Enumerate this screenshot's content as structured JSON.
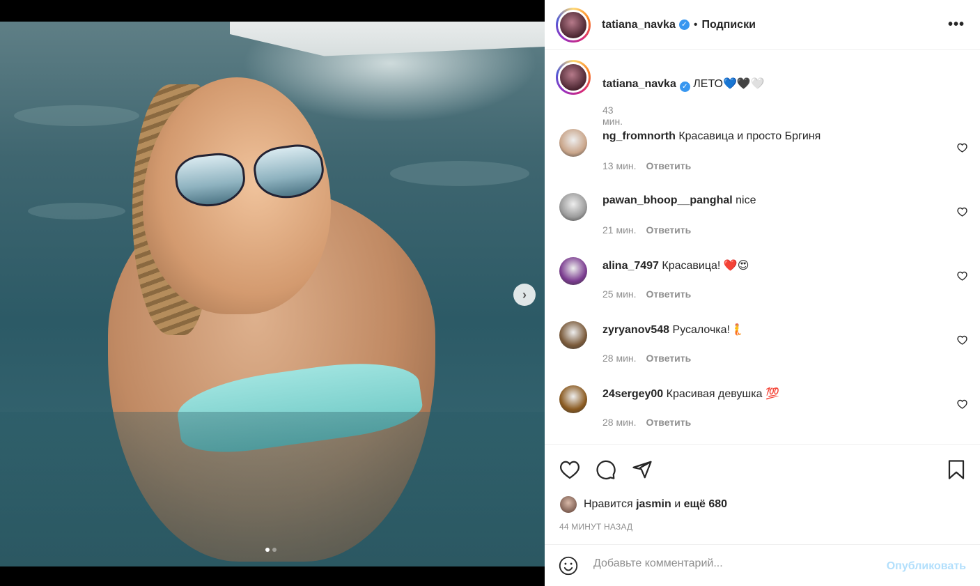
{
  "header": {
    "username": "tatiana_navka",
    "separator": "•",
    "follow_label": "Подписки",
    "more_label": "•••"
  },
  "caption": {
    "username": "tatiana_navka",
    "text": "ЛЕТО💙🖤🤍",
    "time": "43 мин."
  },
  "comments": [
    {
      "username": "ng_fromnorth",
      "text": "Красавица и просто Бргиня",
      "time": "13 мин.",
      "reply": "Ответить",
      "avatar_color": "#c9a58a"
    },
    {
      "username": "pawan_bhoop__panghal",
      "text": "nice",
      "time": "21 мин.",
      "reply": "Ответить",
      "avatar_color": "#9b9b9b"
    },
    {
      "username": "alina_7497",
      "text": "Красавица! ❤️😍",
      "time": "25 мин.",
      "reply": "Ответить",
      "avatar_color": "#7a3b8f"
    },
    {
      "username": "zyryanov548",
      "text": "Русалочка!🧜",
      "time": "28 мин.",
      "reply": "Ответить",
      "avatar_color": "#7a5a3a"
    },
    {
      "username": "24sergey00",
      "text": "Красивая девушка 💯",
      "time": "28 мин.",
      "reply": "Ответить",
      "avatar_color": "#8a5a20"
    }
  ],
  "likes": {
    "prefix": "Нравится",
    "user": "jasmin",
    "and": "и",
    "count": "ещё 680"
  },
  "posted_ago": "44 МИНУТ НАЗАД",
  "add_comment": {
    "placeholder": "Добавьте комментарий...",
    "post_label": "Опубликовать"
  },
  "carousel": {
    "next_label": "›",
    "slide": 1,
    "slides": 2
  },
  "colors": {
    "verified": "#3897f0",
    "muted": "#8e8e8e",
    "post_disabled": "#b2dffc"
  }
}
